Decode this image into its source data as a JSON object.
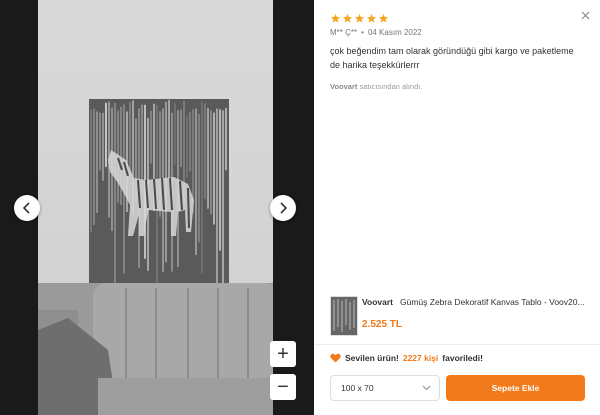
{
  "viewer": {
    "prev_label": "‹",
    "next_label": "›",
    "zoom_in_label": "+",
    "zoom_out_label": "−"
  },
  "review": {
    "rating": 5,
    "author": "M** Ç**",
    "separator": "•",
    "date": "04 Kasım 2022",
    "comment": "çok beğendim tam olarak göründüğü gibi kargo ve paketleme de harika teşekkürlerrr",
    "seller_name": "Voovart",
    "seller_suffix": "satıcısından alındı."
  },
  "product": {
    "brand": "Voovart",
    "name": "Gümüş Zebra Dekoratif Kanvas Tablo - Voov20...",
    "price": "2.525 TL"
  },
  "favorite": {
    "prefix": "Sevilen ürün!",
    "count": "2227 kişi",
    "suffix": "favoriledi!"
  },
  "size_select": {
    "value": "100 x 70"
  },
  "cart_button": {
    "label": "Sepete Ekle"
  },
  "colors": {
    "accent": "#f27a1a",
    "star": "#f5a623",
    "viewer_bg": "#1a1a1a"
  },
  "icons": {
    "close": "close-icon",
    "prev": "chevron-left-icon",
    "next": "chevron-right-icon",
    "heart": "heart-icon",
    "dropdown": "chevron-down-icon",
    "star": "star-icon"
  }
}
